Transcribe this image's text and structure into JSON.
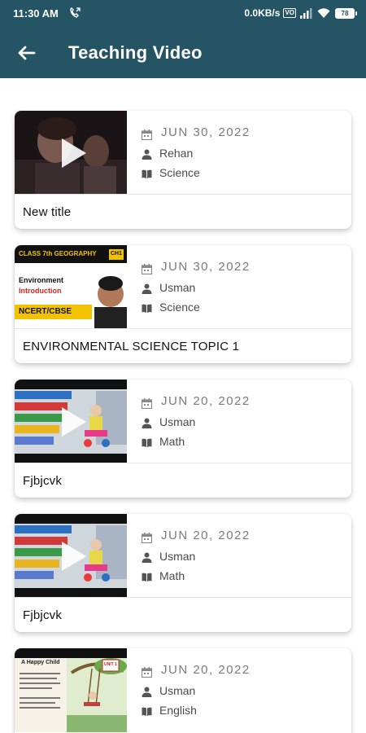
{
  "status_bar": {
    "time": "11:30 AM",
    "network_speed": "0.0KB/s",
    "volte": "VO",
    "battery": "78"
  },
  "header": {
    "title": "Teaching Video",
    "back_icon": "arrow-left-icon"
  },
  "colors": {
    "appbar": "#255565",
    "date_text": "#7b7b7b",
    "meta_text": "#4a4a4a"
  },
  "videos": [
    {
      "date": "JUN 30, 2022",
      "teacher": "Rehan",
      "subject": "Science",
      "title": "New title",
      "thumbnail": "dark-portrait-video"
    },
    {
      "date": "JUN 30, 2022",
      "teacher": "Usman",
      "subject": "Science",
      "title": "ENVIRONMENTAL SCIENCE TOPIC 1",
      "thumbnail": "class-geography-banner",
      "thumb_text": {
        "class": "CLASS 7th GEOGRAPHY",
        "badge": "CH1",
        "line1": "Environment",
        "line2": "Introduction",
        "tag": "NCERT/CBSE"
      }
    },
    {
      "date": "JUN 20, 2022",
      "teacher": "Usman",
      "subject": "Math",
      "title": "Fjbjcvk",
      "thumbnail": "toy-store-video"
    },
    {
      "date": "JUN 20, 2022",
      "teacher": "Usman",
      "subject": "Math",
      "title": "Fjbjcvk",
      "thumbnail": "toy-store-video"
    },
    {
      "date": "JUN 20, 2022",
      "teacher": "Usman",
      "subject": "English",
      "title": "",
      "thumbnail": "happy-child-book-page",
      "thumb_text": {
        "heading": "A Happy Child",
        "badge": "UNIT 1"
      }
    }
  ],
  "icons": {
    "date": "calendar-icon",
    "teacher": "person-icon",
    "subject": "book-icon",
    "play": "play-icon"
  }
}
